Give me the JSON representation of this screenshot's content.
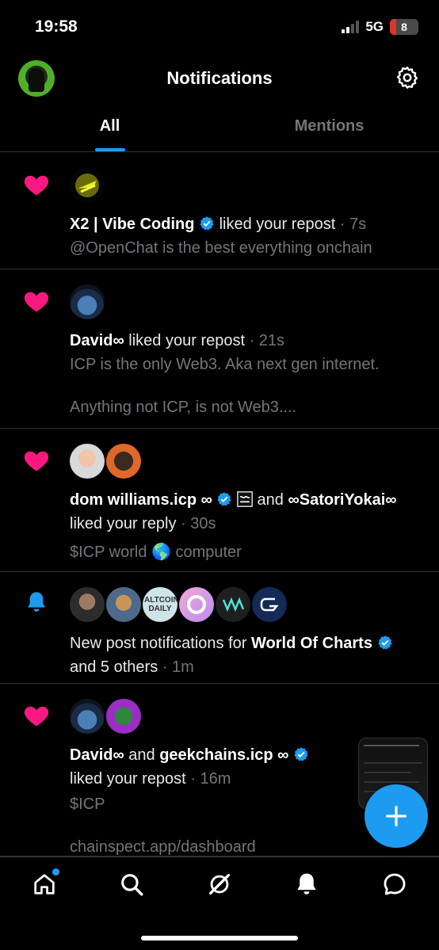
{
  "status": {
    "time": "19:58",
    "network": "5G",
    "battery": "8"
  },
  "header": {
    "title": "Notifications"
  },
  "tabs": [
    {
      "label": "All"
    },
    {
      "label": "Mentions"
    }
  ],
  "notifications": [
    {
      "kind": "like",
      "actor1": "X2 | Vibe Coding",
      "action": " liked your repost",
      "time": "· 7s",
      "snippet1": "@OpenChat is the best everything onchain"
    },
    {
      "kind": "like",
      "actor1": "David∞",
      "action": " liked your repost",
      "time": "· 21s",
      "snippet1": "ICP is the only Web3. Aka next gen internet.",
      "snippet2": "Anything not ICP, is not Web3...."
    },
    {
      "kind": "like",
      "actor1": "dom williams.icp ∞",
      "joiner": " and ",
      "actor2": "∞SatoriYokai∞",
      "action": "liked your reply",
      "time": "· 30s",
      "snippet1": "$ICP world 🌎 computer"
    },
    {
      "kind": "bell",
      "prefix": "New post notifications for ",
      "actor1": "World Of Charts",
      "action": "and 5 others",
      "time": "· 1m",
      "avatar_text": "ALTCOIN DAILY"
    },
    {
      "kind": "like",
      "actor1": "David∞",
      "joiner": " and ",
      "actor2": "geekchains.icp ∞",
      "action": "liked your repost",
      "time": "· 16m",
      "snippet1": "$ICP",
      "snippet2": "chainspect.app/dashboard"
    }
  ],
  "colors": {
    "accent": "#1d9bf0",
    "like": "#f91880",
    "muted": "#71767b",
    "divider": "#2f3336"
  }
}
